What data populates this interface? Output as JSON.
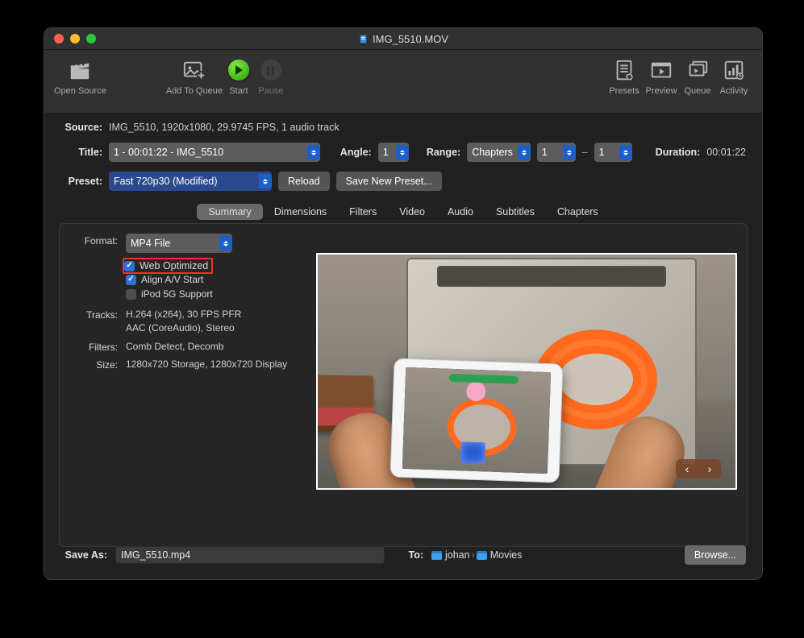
{
  "window": {
    "title": "IMG_5510.MOV"
  },
  "toolbar": {
    "open_source": "Open Source",
    "add_to_queue": "Add To Queue",
    "start": "Start",
    "pause": "Pause",
    "presets": "Presets",
    "preview": "Preview",
    "queue": "Queue",
    "activity": "Activity"
  },
  "labels": {
    "source": "Source:",
    "title": "Title:",
    "angle": "Angle:",
    "range": "Range:",
    "duration": "Duration:",
    "preset": "Preset:",
    "save_as": "Save As:",
    "to": "To:"
  },
  "source": {
    "info": "IMG_5510, 1920x1080, 29.9745 FPS, 1 audio track"
  },
  "title": {
    "selected": "1 - 00:01:22 - IMG_5510",
    "angle": "1"
  },
  "range": {
    "mode": "Chapters",
    "start": "1",
    "end": "1"
  },
  "duration": {
    "value": "00:01:22"
  },
  "preset": {
    "selected": "Fast 720p30 (Modified)",
    "reload": "Reload",
    "save_new": "Save New Preset..."
  },
  "tabs": [
    "Summary",
    "Dimensions",
    "Filters",
    "Video",
    "Audio",
    "Subtitles",
    "Chapters"
  ],
  "summary": {
    "labels": {
      "format": "Format:",
      "tracks": "Tracks:",
      "filters": "Filters:",
      "size": "Size:"
    },
    "format": "MP4 File",
    "checks": {
      "web_optimized": "Web Optimized",
      "align_av": "Align A/V Start",
      "ipod_5g": "iPod 5G Support",
      "web_optimized_checked": true,
      "align_av_checked": true,
      "ipod_5g_checked": false
    },
    "tracks": [
      "H.264 (x264), 30 FPS PFR",
      "AAC (CoreAudio), Stereo"
    ],
    "filters": "Comb Detect, Decomb",
    "size": "1280x720 Storage, 1280x720 Display"
  },
  "save": {
    "filename": "IMG_5510.mp4",
    "path": [
      "johan",
      "Movies"
    ],
    "browse": "Browse..."
  },
  "colors": {
    "accent": "#2b72d6",
    "highlight_border": "#ff2a2a"
  }
}
